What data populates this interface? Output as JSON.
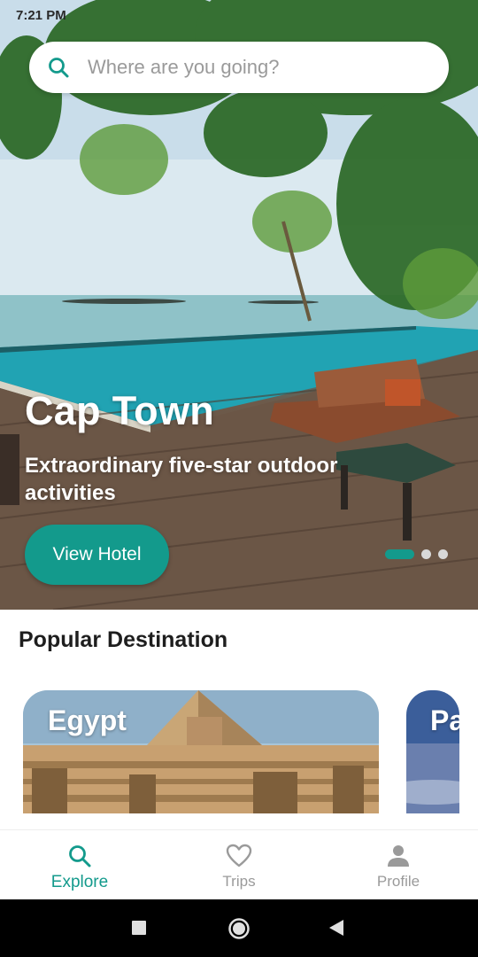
{
  "status_bar": {
    "time": "7:21 PM"
  },
  "search": {
    "placeholder": "Where are you going?",
    "icon": "search-icon"
  },
  "hero": {
    "title": "Cap Town",
    "subtitle": "Extraordinary five-star outdoor activities",
    "button_label": "View Hotel",
    "carousel": {
      "total": 3,
      "active_index": 0
    }
  },
  "popular": {
    "title": "Popular Destination",
    "cards": [
      {
        "label": "Egypt"
      },
      {
        "label": "Pa"
      }
    ]
  },
  "bottom_nav": {
    "items": [
      {
        "label": "Explore",
        "icon": "search-icon",
        "active": true
      },
      {
        "label": "Trips",
        "icon": "heart-icon",
        "active": false
      },
      {
        "label": "Profile",
        "icon": "person-icon",
        "active": false
      }
    ]
  },
  "colors": {
    "accent": "#139a8c",
    "inactive": "#9a9a9a",
    "text": "#1e1e1e"
  }
}
